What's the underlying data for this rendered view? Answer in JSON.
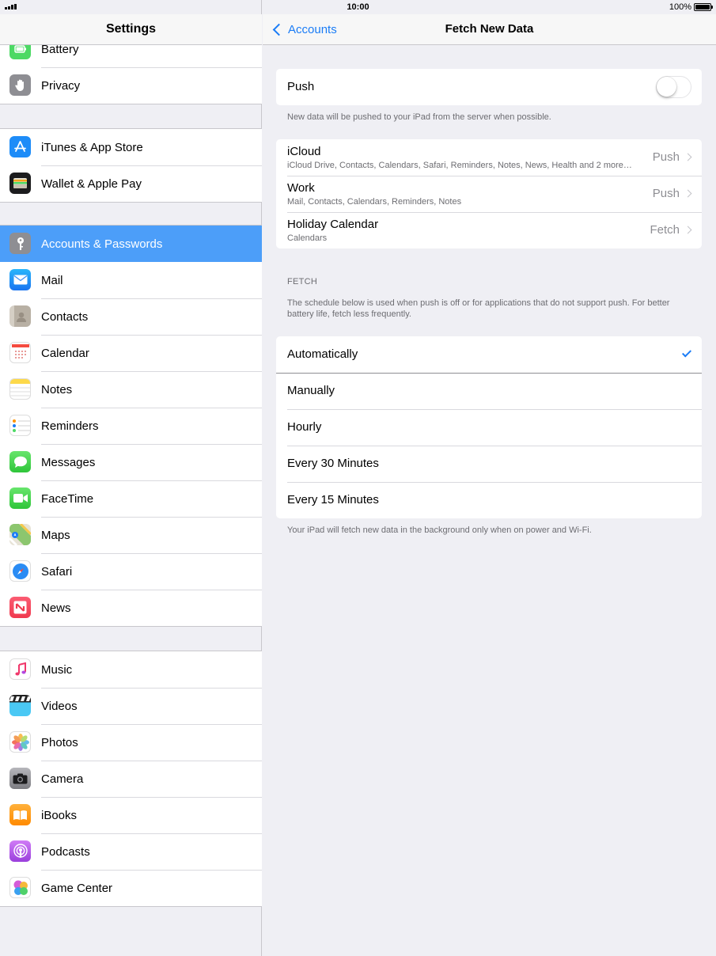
{
  "status": {
    "time": "10:00",
    "battery": "100%"
  },
  "left": {
    "title": "Settings",
    "groups": [
      [
        {
          "label": "Battery",
          "icon": "battery-icon",
          "color": "#4cd964"
        },
        {
          "label": "Privacy",
          "icon": "hand-icon",
          "color": "#8e8e93"
        }
      ],
      [
        {
          "label": "iTunes & App Store",
          "icon": "app-store-icon",
          "color": "#1d8cf8"
        },
        {
          "label": "Wallet & Apple Pay",
          "icon": "wallet-icon",
          "color": "#1c1c1e"
        }
      ],
      [
        {
          "label": "Accounts & Passwords",
          "icon": "key-icon",
          "color": "#8e8e93",
          "selected": true
        },
        {
          "label": "Mail",
          "icon": "mail-icon",
          "color": "#1e8cf7"
        },
        {
          "label": "Contacts",
          "icon": "contacts-icon",
          "color": "#b8b0a4"
        },
        {
          "label": "Calendar",
          "icon": "calendar-icon",
          "color": "#ffffff"
        },
        {
          "label": "Notes",
          "icon": "notes-icon",
          "color": "#ffffff"
        },
        {
          "label": "Reminders",
          "icon": "reminders-icon",
          "color": "#ffffff"
        },
        {
          "label": "Messages",
          "icon": "messages-icon",
          "color": "#4cd964"
        },
        {
          "label": "FaceTime",
          "icon": "facetime-icon",
          "color": "#4cd964"
        },
        {
          "label": "Maps",
          "icon": "maps-icon",
          "color": "#8cc66e"
        },
        {
          "label": "Safari",
          "icon": "safari-icon",
          "color": "#2a8cf4"
        },
        {
          "label": "News",
          "icon": "news-icon",
          "color": "#f4445c"
        }
      ],
      [
        {
          "label": "Music",
          "icon": "music-icon",
          "color": "#ffffff"
        },
        {
          "label": "Videos",
          "icon": "videos-icon",
          "color": "#4ac8f4"
        },
        {
          "label": "Photos",
          "icon": "photos-icon",
          "color": "#ffffff"
        },
        {
          "label": "Camera",
          "icon": "camera-icon",
          "color": "#8e8e93"
        },
        {
          "label": "iBooks",
          "icon": "ibooks-icon",
          "color": "#ff9500"
        },
        {
          "label": "Podcasts",
          "icon": "podcasts-icon",
          "color": "#b560e8"
        },
        {
          "label": "Game Center",
          "icon": "game-center-icon",
          "color": "#ffffff"
        }
      ]
    ]
  },
  "right": {
    "back_label": "Accounts",
    "title": "Fetch New Data",
    "push_label": "Push",
    "push_on": false,
    "push_note": "New data will be pushed to your iPad from the server when possible.",
    "accounts": [
      {
        "name": "iCloud",
        "detail": "iCloud Drive, Contacts, Calendars, Safari, Reminders, Notes, News, Health and 2 more…",
        "value": "Push"
      },
      {
        "name": "Work",
        "detail": "Mail, Contacts, Calendars, Reminders, Notes",
        "value": "Push"
      },
      {
        "name": "Holiday Calendar",
        "detail": "Calendars",
        "value": "Fetch"
      }
    ],
    "fetch_heading": "FETCH",
    "fetch_note": "The schedule below is used when push is off or for applications that do not support push. For better battery life, fetch less frequently.",
    "schedule": [
      {
        "label": "Automatically",
        "checked": true
      },
      {
        "label": "Manually"
      },
      {
        "label": "Hourly"
      },
      {
        "label": "Every 30 Minutes"
      },
      {
        "label": "Every 15 Minutes"
      }
    ],
    "footer_note": "Your iPad will fetch new data in the background only when on power and Wi-Fi."
  }
}
